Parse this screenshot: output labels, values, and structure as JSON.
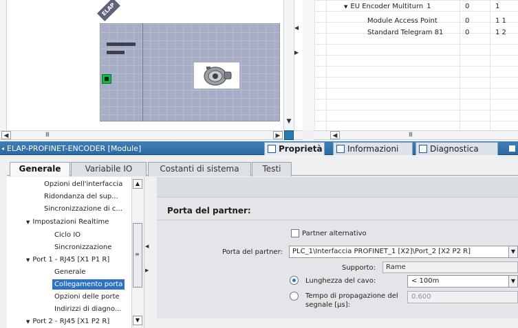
{
  "device_view": {
    "module_tag": "ELAP"
  },
  "device_table": {
    "rows": [
      {
        "name": "EU Encoder Multiturn_1",
        "rack": "0",
        "slot": "1"
      },
      {
        "name": "Module Access Point",
        "rack": "0",
        "slot": "1 1"
      },
      {
        "name": "Standard Telegram 81",
        "rack": "0",
        "slot": "1 2"
      }
    ]
  },
  "scrollbars": {
    "left_grip": "III",
    "right_grip": "III"
  },
  "inspector": {
    "title": "ELAP-PROFINET-ENCODER [Module]",
    "tabs": {
      "properties": "Proprietà",
      "info": "Informazioni",
      "diagnostics": "Diagnostica"
    },
    "subtabs": [
      "Generale",
      "Variabile IO",
      "Costanti di sistema",
      "Testi"
    ]
  },
  "nav_tree": {
    "items": [
      "Opzioni dell'interfaccia",
      "Ridondanza del sup...",
      "Sincronizzazione di c...",
      "Impostazioni Realtime",
      "Ciclo IO",
      "Sincronizzazione",
      "Port 1 - RJ45 [X1 P1 R]",
      "Generale",
      "Collegamento porta",
      "Opzioni delle porte",
      "Indirizzi di diagno...",
      "Port 2 - RJ45 [X1 P2 R]"
    ],
    "selected": "Collegamento porta"
  },
  "content": {
    "section_title": "Porta del partner:",
    "partner_alt_label": "Partner alternativo",
    "partner_alt_checked": false,
    "partner_port_label": "Porta del partner:",
    "partner_port_value": "PLC_1\\Interfaccia PROFINET_1 [X2]\\Port_2 [X2 P2 R]",
    "medium_label": "Supporto:",
    "medium_value": "Rame",
    "cable_length_label": "Lunghezza del cavo:",
    "cable_length_value": "< 100m",
    "signal_delay_label_1": "Tempo di propagazione del",
    "signal_delay_label_2": "segnale [µs]:",
    "signal_delay_value": "0.600",
    "selected_option": "Lunghezza del cavo"
  },
  "colors": {
    "title_bar": "#3f7fb7",
    "selection": "#2f72c4",
    "module": "#a7adc5",
    "port_led": "#18b54a"
  },
  "icons": {
    "proprieta": "properties-icon",
    "informazioni": "info-icon",
    "diagnostica": "diagnostics-icon"
  }
}
